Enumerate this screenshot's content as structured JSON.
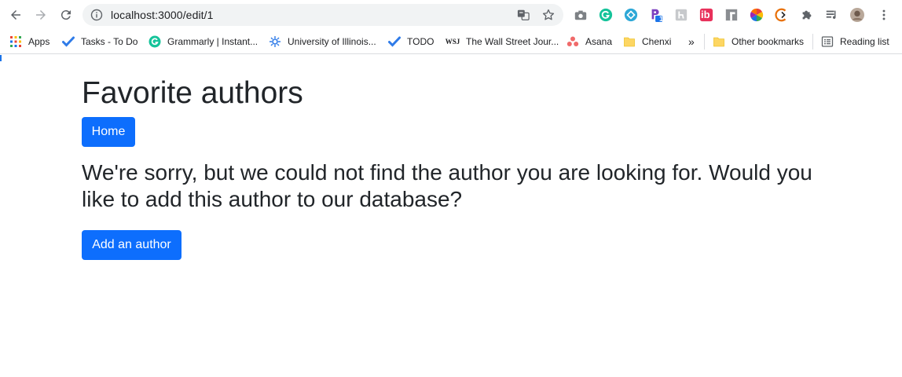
{
  "browser": {
    "url": "localhost:3000/edit/1",
    "bookmarks": [
      {
        "label": "Apps",
        "icon": "apps-grid-icon"
      },
      {
        "label": "Tasks - To Do",
        "icon": "todo-check-icon"
      },
      {
        "label": "Grammarly | Instant...",
        "icon": "grammarly-icon"
      },
      {
        "label": "University of Illinois...",
        "icon": "illinois-icon"
      },
      {
        "label": "TODO",
        "icon": "todo-check-icon"
      },
      {
        "label": "The Wall Street Jour...",
        "icon": "wsj-icon"
      },
      {
        "label": "Asana",
        "icon": "asana-icon"
      },
      {
        "label": "Chenxi",
        "icon": "folder-icon"
      }
    ],
    "overflow_label": "»",
    "other_bookmarks": "Other bookmarks",
    "reading_list": "Reading list",
    "wsj_mark": "WSJ",
    "ib_mark": "ib",
    "p_badge": "1",
    "accent": "#1a73e8"
  },
  "page": {
    "title": "Favorite authors",
    "home_button": "Home",
    "message": "We're sorry, but we could not find the author you are looking for. Would you like to add this author to our database?",
    "add_button": "Add an author",
    "button_color": "#0d6efd"
  }
}
